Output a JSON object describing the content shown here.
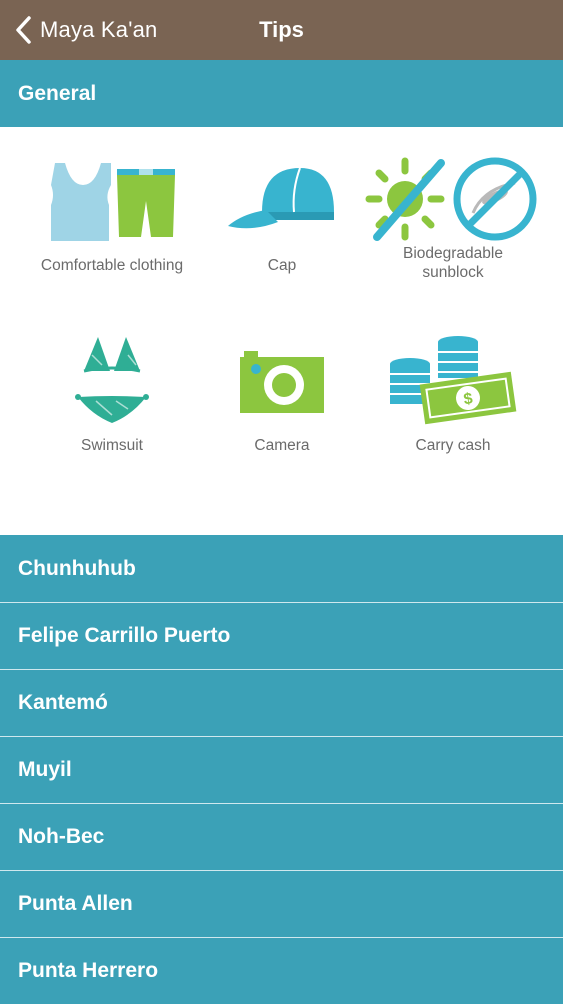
{
  "nav": {
    "back_label": "Maya Ka'an",
    "title": "Tips"
  },
  "section": {
    "title": "General"
  },
  "tips": [
    {
      "label": "Comfortable clothing",
      "icon": "clothing-icon"
    },
    {
      "label": "Cap",
      "icon": "cap-icon"
    },
    {
      "label": "Biodegradable sunblock",
      "icon": "sunblock-mosquito-icon"
    },
    {
      "label": "Swimsuit",
      "icon": "swimsuit-icon"
    },
    {
      "label": "Camera",
      "icon": "camera-icon"
    },
    {
      "label": "Carry cash",
      "icon": "cash-icon"
    }
  ],
  "destinations": [
    {
      "label": "Chunhuhub"
    },
    {
      "label": "Felipe Carrillo Puerto"
    },
    {
      "label": "Kantemó"
    },
    {
      "label": "Muyil"
    },
    {
      "label": "Noh-Bec"
    },
    {
      "label": "Punta Allen"
    },
    {
      "label": "Punta Herrero"
    }
  ],
  "colors": {
    "navbar": "#7a6453",
    "accent": "#3ba1b7",
    "icon_green": "#8cc63f",
    "icon_blue": "#38b4cf"
  }
}
